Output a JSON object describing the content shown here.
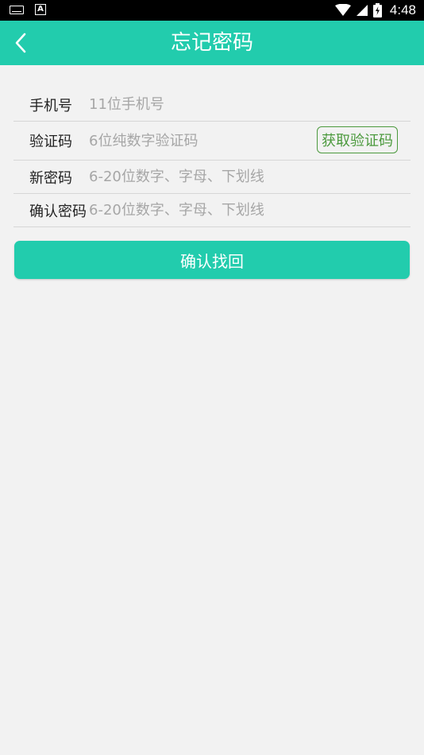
{
  "status_bar": {
    "time": "4:48",
    "icons": [
      "keyboard-icon",
      "a-notification-icon",
      "wifi-icon",
      "signal-icon",
      "battery-icon"
    ]
  },
  "header": {
    "title": "忘记密码",
    "back_icon": "chevron-left-icon"
  },
  "form": {
    "phone": {
      "label": "手机号",
      "placeholder": "11位手机号"
    },
    "code": {
      "label": "验证码",
      "placeholder": "6位纯数字验证码",
      "button": "获取验证码"
    },
    "new_password": {
      "label": "新密码",
      "placeholder": "6-20位数字、字母、下划线"
    },
    "confirm_password": {
      "label": "确认密码",
      "placeholder": "6-20位数字、字母、下划线"
    }
  },
  "submit_label": "确认找回",
  "colors": {
    "accent": "#22ccad",
    "code_button": "#4c9a3e",
    "background": "#f2f2f2"
  }
}
